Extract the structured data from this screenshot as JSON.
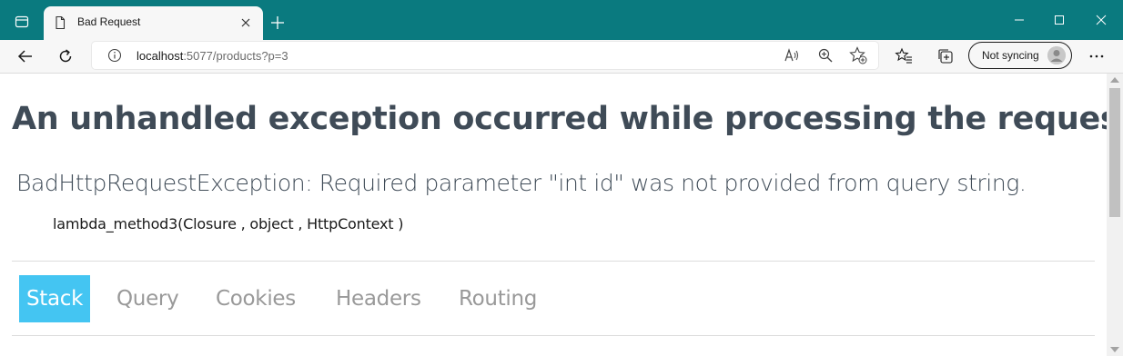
{
  "browser": {
    "tab": {
      "title": "Bad Request",
      "favicon": "page-icon"
    },
    "address": {
      "host": "localhost",
      "rest": ":5077/products?p=3"
    },
    "sync_label": "Not syncing",
    "colors": {
      "titlebar": "#0a7a7f",
      "toolbar": "#f7f7f7"
    },
    "icons": {
      "tab_actions": "tab-actions-icon",
      "close_tab": "close-icon",
      "new_tab": "plus-icon",
      "back": "back-arrow-icon",
      "refresh": "refresh-icon",
      "info": "info-icon",
      "read_aloud": "read-aloud-icon",
      "zoom": "zoom-icon",
      "favorite": "add-favorite-icon",
      "favorites": "favorites-icon",
      "collections": "collections-icon",
      "menu": "more-icon"
    }
  },
  "page": {
    "heading": "An unhandled exception occurred while processing the request.",
    "exception": "BadHttpRequestException: Required parameter \"int id\" was not provided from query string.",
    "location": "lambda_method3(Closure , object , HttpContext )",
    "tabs": [
      {
        "label": "Stack",
        "selected": true
      },
      {
        "label": "Query",
        "selected": false
      },
      {
        "label": "Cookies",
        "selected": false
      },
      {
        "label": "Headers",
        "selected": false
      },
      {
        "label": "Routing",
        "selected": false
      }
    ],
    "colors": {
      "heading": "#3f4b57",
      "selected_tab": "#44c5f2",
      "tab_text": "#999999"
    }
  }
}
